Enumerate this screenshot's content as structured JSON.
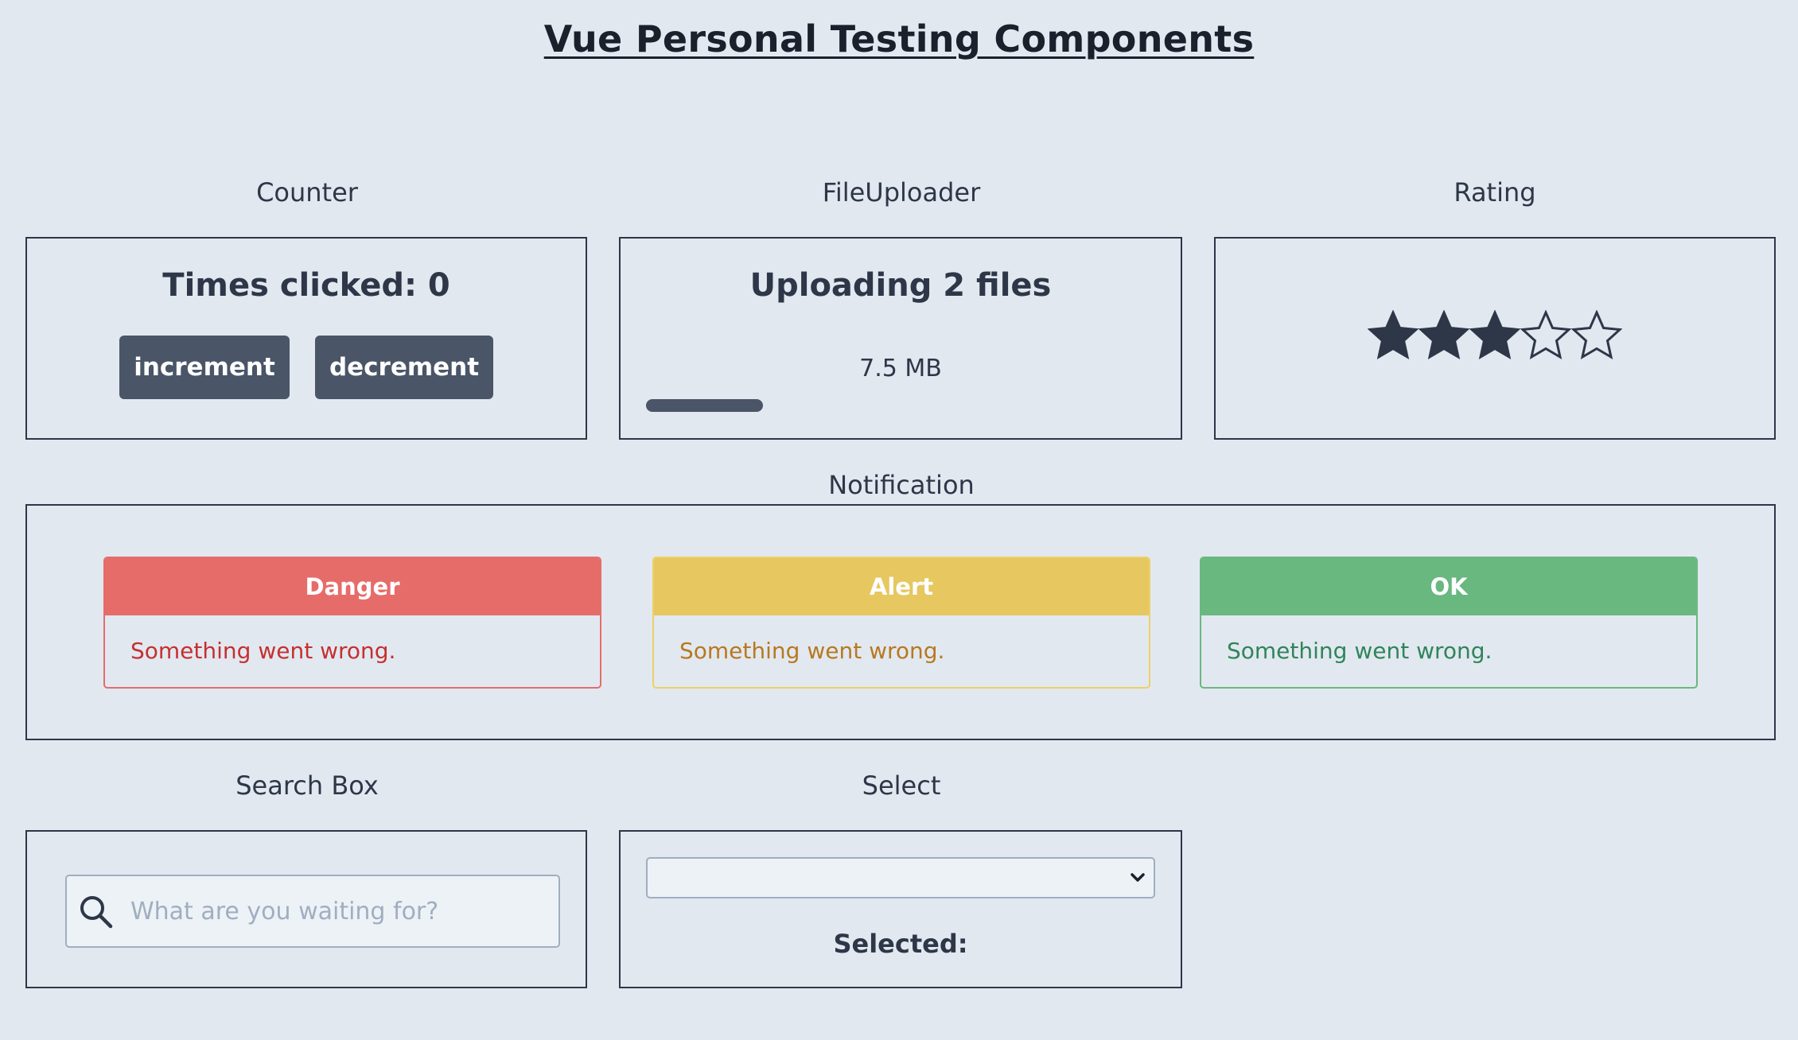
{
  "page": {
    "title": "Vue Personal Testing Components"
  },
  "counter": {
    "label": "Counter",
    "text": "Times clicked: 0",
    "increment_label": "increment",
    "decrement_label": "decrement"
  },
  "file_uploader": {
    "label": "FileUploader",
    "title": "Uploading 2 files",
    "size": "7.5 MB",
    "progress_fraction": 0.23
  },
  "rating": {
    "label": "Rating",
    "value": 3,
    "max": 5
  },
  "notification": {
    "label": "Notification",
    "items": [
      {
        "title": "Danger",
        "message": "Something went wrong.",
        "header_color": "#e66c6a",
        "border_color": "#e66c6a",
        "text_color": "#c53030"
      },
      {
        "title": "Alert",
        "message": "Something went wrong.",
        "header_color": "#e6c760",
        "border_color": "#ecd067",
        "text_color": "#b7791f"
      },
      {
        "title": "OK",
        "message": "Something went wrong.",
        "header_color": "#69b87f",
        "border_color": "#69b87f",
        "text_color": "#2f855a"
      }
    ]
  },
  "search_box": {
    "label": "Search Box",
    "placeholder": "What are you waiting for?",
    "value": ""
  },
  "select": {
    "label": "Select",
    "value": "",
    "selected_label": "Selected:"
  },
  "colors": {
    "background": "#e2e8f0",
    "panel_border": "#2d3748",
    "button": "#4a5568",
    "star": "#2d3748"
  }
}
